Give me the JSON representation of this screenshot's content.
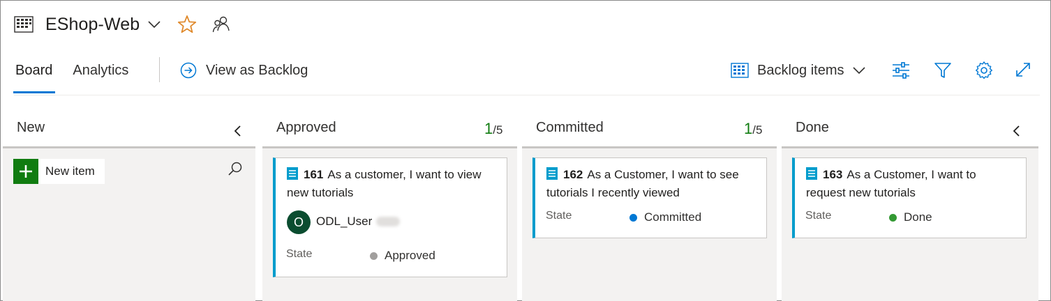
{
  "header": {
    "title": "EShop-Web"
  },
  "tabs": [
    {
      "label": "Board",
      "active": true
    },
    {
      "label": "Analytics",
      "active": false
    }
  ],
  "toolbar": {
    "view_as_backlog": "View as Backlog",
    "backlog_level": "Backlog items"
  },
  "columns": [
    {
      "name": "New",
      "count": "",
      "limit": ""
    },
    {
      "name": "Approved",
      "count": "1",
      "limit": "/5"
    },
    {
      "name": "Committed",
      "count": "1",
      "limit": "/5"
    },
    {
      "name": "Done",
      "count": "",
      "limit": ""
    }
  ],
  "new_item_label": "New item",
  "cards": [
    {
      "id": "161",
      "title_line1": "As a customer, I want to view",
      "title_line2": "new tutorials",
      "assignee_initial": "O",
      "assignee": "ODL_User",
      "state_label": "State",
      "state": "Approved",
      "state_color": "#a19f9d"
    },
    {
      "id": "162",
      "title_line1": "As a Customer, I want to see",
      "title_line2": "tutorials I recently viewed",
      "state_label": "State",
      "state": "Committed",
      "state_color": "#0078d4"
    },
    {
      "id": "163",
      "title_line1": "As a Customer, I want to",
      "title_line2": "request new tutorials",
      "state_label": "State",
      "state": "Done",
      "state_color": "#339933"
    }
  ],
  "colors": {
    "accent": "#0078d4",
    "card_border": "#009ccc",
    "count_green": "#107c10",
    "star": "#e08a2d"
  },
  "icons": [
    "board-icon",
    "chevron-down-icon",
    "star-icon",
    "team-members-icon",
    "arrow-circle-right-icon",
    "backlog-grid-icon",
    "settings-sliders-icon",
    "filter-icon",
    "gear-icon",
    "expand-icon",
    "collapse-chevron-icon",
    "plus-icon",
    "search-icon",
    "work-item-icon"
  ]
}
